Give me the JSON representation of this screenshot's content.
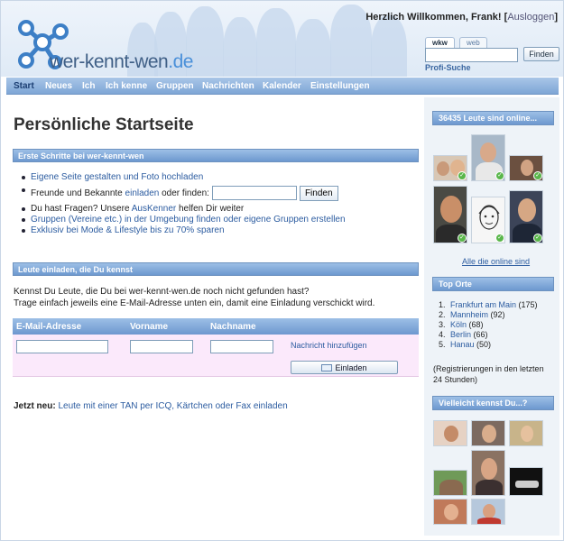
{
  "header": {
    "logo_main": "wer-kennt-wen",
    "logo_tld": ".de",
    "welcome": "Herzlich Willkommen, Frank!",
    "logout_label": "Ausloggen",
    "search_tabs": [
      "wkw",
      "web"
    ],
    "search_button": "Finden",
    "profi_search": "Profi-Suche"
  },
  "nav": {
    "items": [
      "Start",
      "Neues",
      "Ich",
      "Ich kenne",
      "Gruppen",
      "Nachrichten",
      "Kalender",
      "Einstellungen"
    ],
    "active": "Start"
  },
  "main": {
    "title": "Persönliche Startseite",
    "first_steps": {
      "title": "Erste Schritte bei wer-kennt-wen",
      "items": {
        "own_page": "Eigene Seite gestalten und Foto hochladen",
        "invite_pre": "Freunde und Bekannte ",
        "invite_link": "einladen",
        "invite_post": " oder finden:",
        "find_button": "Finden",
        "questions_pre": "Du hast Fragen? Unsere ",
        "questions_link": "AusKenner",
        "questions_post": " helfen Dir weiter",
        "groups": "Gruppen (Vereine etc.) in der Umgebung finden oder eigene Gruppen erstellen",
        "fashion": "Exklusiv bei Mode & Lifestyle bis zu 70% sparen"
      }
    },
    "invite": {
      "title": "Leute einladen, die Du kennst",
      "intro_line1": "Kennst Du Leute, die Du bei wer-kennt-wen.de noch nicht gefunden hast?",
      "intro_line2": "Trage einfach jeweils eine E-Mail-Adresse unten ein, damit eine Einladung verschickt wird.",
      "columns": [
        "E-Mail-Adresse",
        "Vorname",
        "Nachname"
      ],
      "add_message": "Nachricht hinzufügen",
      "invite_button": "Einladen"
    },
    "jetzt_neu": {
      "label": "Jetzt neu:",
      "link": "Leute mit einer TAN per ICQ, Kärtchen oder Fax einladen"
    }
  },
  "sidebar": {
    "online_title": "36435 Leute sind online...",
    "all_online": "Alle die online sind",
    "top_places_title": "Top Orte",
    "top_places": [
      {
        "rank": "1.",
        "name": "Frankfurt am Main",
        "count": "(175)"
      },
      {
        "rank": "2.",
        "name": "Mannheim",
        "count": "(92)"
      },
      {
        "rank": "3.",
        "name": "Köln",
        "count": "(68)"
      },
      {
        "rank": "4.",
        "name": "Berlin",
        "count": "(66)"
      },
      {
        "rank": "5.",
        "name": "Hanau",
        "count": "(50)"
      }
    ],
    "registration_note": "(Registrierungen in den letzten 24 Stunden)",
    "maybe_know_title": "Vielleicht kennst Du...?"
  },
  "colors": {
    "nav_blue": "#7ea6d6",
    "link_blue": "#2c5ca0",
    "invite_pink": "#fbe9fb",
    "online_green": "#59b64a"
  }
}
